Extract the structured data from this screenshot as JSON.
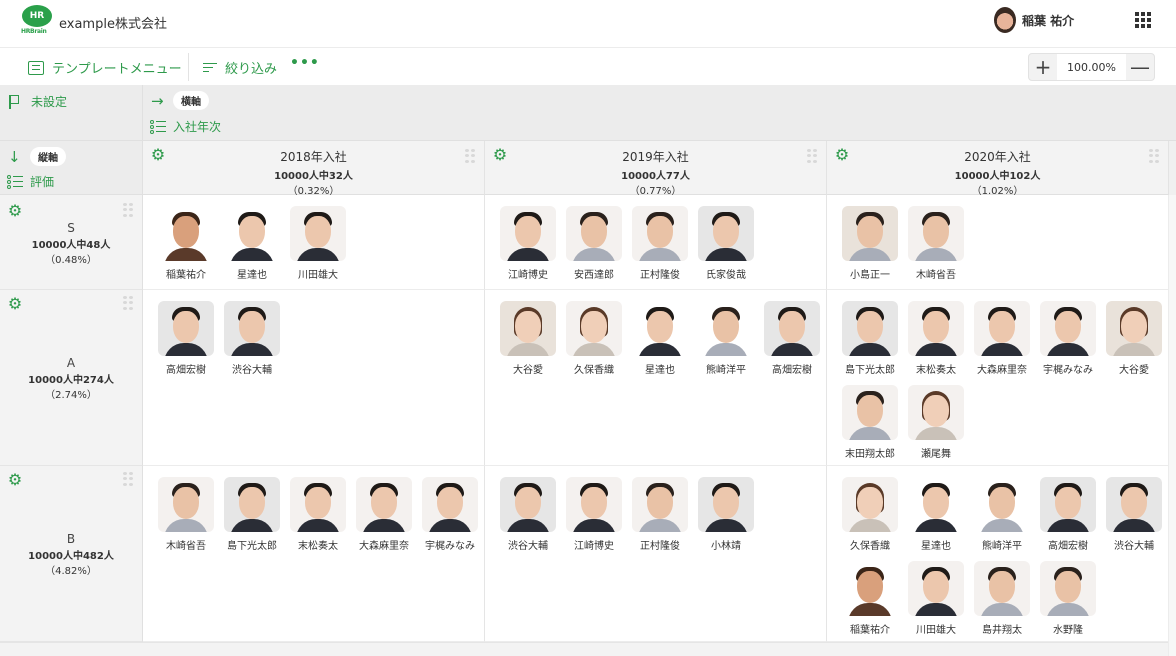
{
  "header": {
    "logo_text": "HR",
    "logo_brand": "HRBrain",
    "company": "example株式会社",
    "user_name": "稲葉 祐介"
  },
  "toolbar": {
    "template_menu": "テンプレートメニュー",
    "filter": "絞り込み",
    "more": "•••",
    "zoom_in": "+",
    "zoom_value": "100.00%",
    "zoom_out": "—"
  },
  "axes": {
    "unset_label": "未設定",
    "horizontal_pill": "横軸",
    "horizontal_field": "入社年次",
    "vertical_pill": "縦軸",
    "vertical_field": "評価",
    "arrow_right": "→",
    "arrow_down": "↓"
  },
  "columns": [
    {
      "title": "2018年入社",
      "count": "10000人中32人",
      "pct": "（0.32%）"
    },
    {
      "title": "2019年入社",
      "count": "10000人77人",
      "pct": "（0.77%）"
    },
    {
      "title": "2020年入社",
      "count": "10000人中102人",
      "pct": "（1.02%）"
    }
  ],
  "rows": [
    {
      "title": "S",
      "count": "10000人中48人",
      "pct": "（0.48%）",
      "cells": [
        [
          {
            "name": "稲葉祐介",
            "tone": "warm",
            "bg": "none"
          },
          {
            "name": "星達也",
            "tone": "suit",
            "bg": "none"
          },
          {
            "name": "川田雄大",
            "tone": "suit",
            "bg": "light"
          }
        ],
        [
          {
            "name": "江崎博史",
            "tone": "suit",
            "bg": "light"
          },
          {
            "name": "安西達郎",
            "tone": "casual",
            "bg": "light"
          },
          {
            "name": "正村隆俊",
            "tone": "casual",
            "bg": "light"
          },
          {
            "name": "氏家俊哉",
            "tone": "suit",
            "bg": "grey"
          }
        ],
        [
          {
            "name": "小島正一",
            "tone": "casual",
            "bg": "beige"
          },
          {
            "name": "木崎省吾",
            "tone": "casual",
            "bg": "light"
          }
        ]
      ]
    },
    {
      "title": "A",
      "count": "10000人中274人",
      "pct": "（2.74%）",
      "cells": [
        [
          {
            "name": "高畑宏樹",
            "tone": "suit",
            "bg": "grey"
          },
          {
            "name": "渋谷大輔",
            "tone": "suit",
            "bg": "grey"
          }
        ],
        [
          {
            "name": "大谷愛",
            "tone": "female",
            "bg": "beige"
          },
          {
            "name": "久保香織",
            "tone": "female",
            "bg": "light"
          },
          {
            "name": "星達也",
            "tone": "suit",
            "bg": "none"
          },
          {
            "name": "熊崎洋平",
            "tone": "casual",
            "bg": "none"
          },
          {
            "name": "高畑宏樹",
            "tone": "suit",
            "bg": "grey"
          }
        ],
        [
          {
            "name": "島下光太郎",
            "tone": "suit",
            "bg": "grey"
          },
          {
            "name": "末松奏太",
            "tone": "suit",
            "bg": "light"
          },
          {
            "name": "大森麻里奈",
            "tone": "suit",
            "bg": "light"
          },
          {
            "name": "宇梶みなみ",
            "tone": "suit",
            "bg": "light"
          },
          {
            "name": "大谷愛",
            "tone": "female",
            "bg": "beige"
          },
          {
            "name": "末田翔太郎",
            "tone": "casual",
            "bg": "light"
          },
          {
            "name": "瀬尾舞",
            "tone": "female",
            "bg": "light"
          }
        ]
      ]
    },
    {
      "title": "B",
      "count": "10000人中482人",
      "pct": "（4.82%）",
      "cells": [
        [
          {
            "name": "木崎省吾",
            "tone": "casual",
            "bg": "light"
          },
          {
            "name": "島下光太郎",
            "tone": "suit",
            "bg": "grey"
          },
          {
            "name": "末松奏太",
            "tone": "suit",
            "bg": "light"
          },
          {
            "name": "大森麻里奈",
            "tone": "suit",
            "bg": "light"
          },
          {
            "name": "宇梶みなみ",
            "tone": "suit",
            "bg": "light"
          }
        ],
        [
          {
            "name": "渋谷大輔",
            "tone": "suit",
            "bg": "grey"
          },
          {
            "name": "江崎博史",
            "tone": "suit",
            "bg": "light"
          },
          {
            "name": "正村隆俊",
            "tone": "casual",
            "bg": "light"
          },
          {
            "name": "小林靖",
            "tone": "suit",
            "bg": "grey"
          }
        ],
        [
          {
            "name": "久保香織",
            "tone": "female",
            "bg": "light"
          },
          {
            "name": "星達也",
            "tone": "suit",
            "bg": "none"
          },
          {
            "name": "熊崎洋平",
            "tone": "casual",
            "bg": "none"
          },
          {
            "name": "高畑宏樹",
            "tone": "suit",
            "bg": "grey"
          },
          {
            "name": "渋谷大輔",
            "tone": "suit",
            "bg": "grey"
          },
          {
            "name": "稲葉祐介",
            "tone": "warm",
            "bg": "none"
          },
          {
            "name": "川田雄大",
            "tone": "suit",
            "bg": "light"
          },
          {
            "name": "島井翔太",
            "tone": "casual",
            "bg": "light"
          },
          {
            "name": "水野隆",
            "tone": "casual",
            "bg": "light"
          }
        ]
      ]
    }
  ],
  "colors": {
    "accent": "#2e9a4b",
    "header_bg": "#ececec",
    "cell_bg": "#ffffff"
  }
}
